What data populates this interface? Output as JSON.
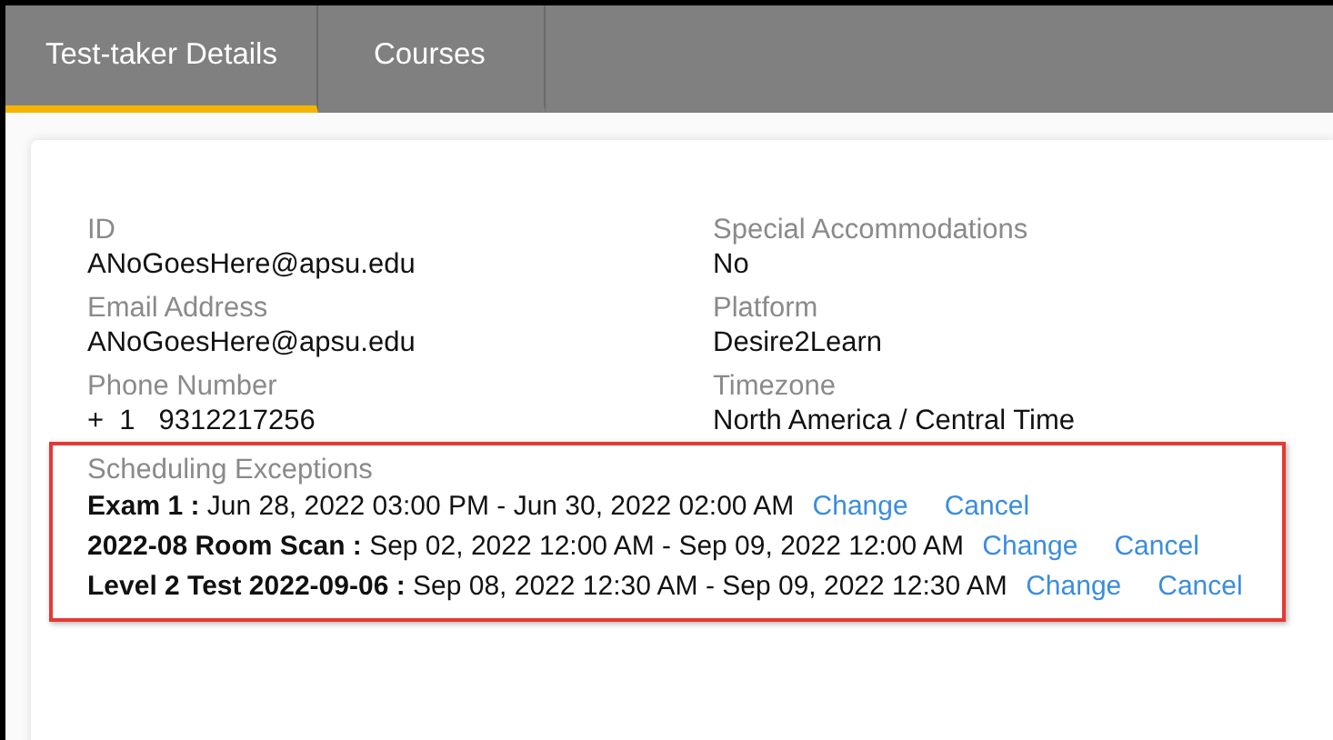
{
  "tabs": [
    {
      "label": "Test-taker Details",
      "selected": true
    },
    {
      "label": "Courses",
      "selected": false
    }
  ],
  "fields": [
    {
      "label": "ID",
      "value": "ANoGoesHere@apsu.edu"
    },
    {
      "label": "Special Accommodations",
      "value": "No"
    },
    {
      "label": "Email Address",
      "value": "ANoGoesHere@apsu.edu"
    },
    {
      "label": "Platform",
      "value": "Desire2Learn"
    },
    {
      "label": "Phone Number",
      "value": "+  1   9312217256"
    },
    {
      "label": "Timezone",
      "value": "North America / Central Time"
    }
  ],
  "scheduling_exceptions": {
    "title": "Scheduling Exceptions",
    "items": [
      {
        "name": "Exam 1 :",
        "range": "Jun 28, 2022 03:00 PM - Jun 30, 2022 02:00 AM",
        "actions": [
          "Change",
          "Cancel"
        ]
      },
      {
        "name": "2022-08 Room Scan :",
        "range": "Sep 02, 2022 12:00 AM - Sep 09, 2022 12:00 AM",
        "actions": [
          "Change",
          "Cancel"
        ]
      },
      {
        "name": "Level 2 Test 2022-09-06 :",
        "range": "Sep 08, 2022 12:30 AM - Sep 09, 2022 12:30 AM",
        "actions": [
          "Change",
          "Cancel"
        ]
      }
    ]
  }
}
